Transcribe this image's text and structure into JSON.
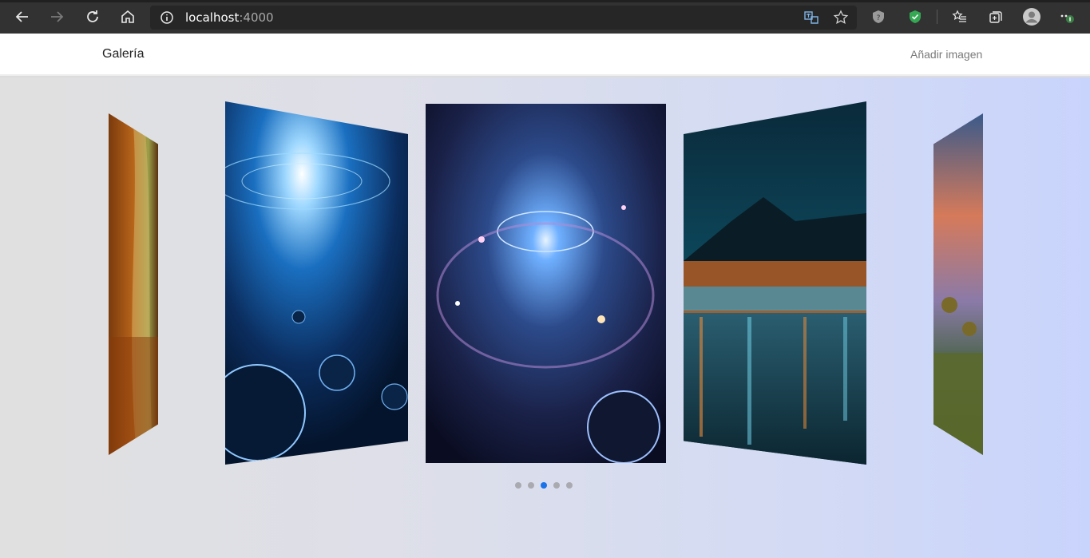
{
  "browser": {
    "url_host": "localhost",
    "url_port": ":4000",
    "icons": [
      "back-arrow-icon",
      "forward-arrow-icon",
      "refresh-icon",
      "home-icon",
      "info-icon",
      "translate-icon",
      "star-icon",
      "shield-icon",
      "shield-check-icon",
      "favorites-icon",
      "collections-icon",
      "profile-icon",
      "more-icon"
    ]
  },
  "app": {
    "brand": "Galería",
    "add_image": "Añadir imagen"
  },
  "gallery": {
    "slides": [
      "autumn-forest-path",
      "blue-galaxy-planets",
      "nebula-galaxy",
      "night-city-lake",
      "sunset-sunflowers"
    ],
    "active_index": 2,
    "dots": 5
  },
  "colors": {
    "accent": "#1a73e8",
    "chrome": "#323232"
  }
}
